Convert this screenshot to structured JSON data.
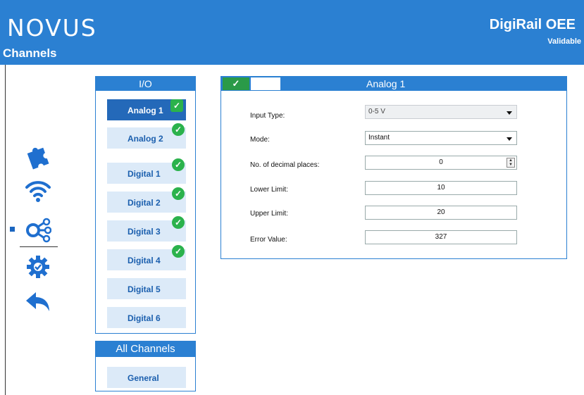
{
  "header": {
    "logo": "NOVUS",
    "page_title": "Channels",
    "product_name": "DigiRail OEE",
    "product_subtitle": "Validable",
    "background_color": "#2b80d2"
  },
  "nav_icons": [
    "puzzle-icon",
    "wifi-icon",
    "network-nodes-icon",
    "settings-gear-check-icon",
    "back-arrow-icon"
  ],
  "io_panel": {
    "title": "I/O",
    "channels": [
      {
        "label": "Analog 1",
        "checked": true,
        "selected": true
      },
      {
        "label": "Analog 2",
        "checked": true
      },
      {
        "label": "Digital 1",
        "checked": true
      },
      {
        "label": "Digital 2",
        "checked": true
      },
      {
        "label": "Digital 3",
        "checked": true
      },
      {
        "label": "Digital 4",
        "checked": true
      },
      {
        "label": "Digital 5",
        "checked": false
      },
      {
        "label": "Digital 6",
        "checked": false
      }
    ],
    "check_glyph": "✓"
  },
  "all_channels_panel": {
    "title": "All Channels",
    "item": "General"
  },
  "channel_panel": {
    "title": "Analog 1",
    "tab_ok_glyph": "✓",
    "fields": {
      "input_type": {
        "label": "Input Type:",
        "value": "0-5 V"
      },
      "mode": {
        "label": "Mode:",
        "value": "Instant"
      },
      "decimals": {
        "label": "No. of decimal places:",
        "value": "0"
      },
      "lower_limit": {
        "label": "Lower Limit:",
        "value": "10"
      },
      "upper_limit": {
        "label": "Upper Limit:",
        "value": "20"
      },
      "error_value": {
        "label": "Error Value:",
        "value": "327"
      }
    }
  },
  "spin_up": "▲",
  "spin_down": "▼",
  "colors": {
    "accent": "#2b80d2",
    "selected": "#2469b9",
    "ok_green": "#2bb24c"
  }
}
